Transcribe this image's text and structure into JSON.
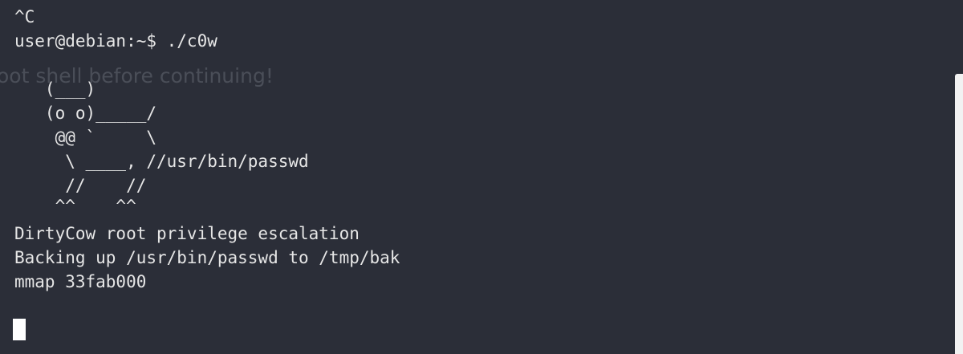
{
  "terminal": {
    "lines": [
      "^C",
      "user@debian:~$ ./c0w",
      "",
      "   (___)",
      "   (o o)_____/",
      "    @@ `     \\",
      "     \\ ____, //usr/bin/passwd",
      "     //    //",
      "    ^^    ^^",
      "DirtyCow root privilege escalation",
      "Backing up /usr/bin/passwd to /tmp/bak",
      "mmap 33fab000"
    ],
    "ghost_text": "oot shell before continuing!"
  },
  "colors": {
    "background": "#2b2e38",
    "text": "#e6e6e6",
    "cursor": "#ffffff",
    "scrollbar": "#f2f2f2"
  }
}
